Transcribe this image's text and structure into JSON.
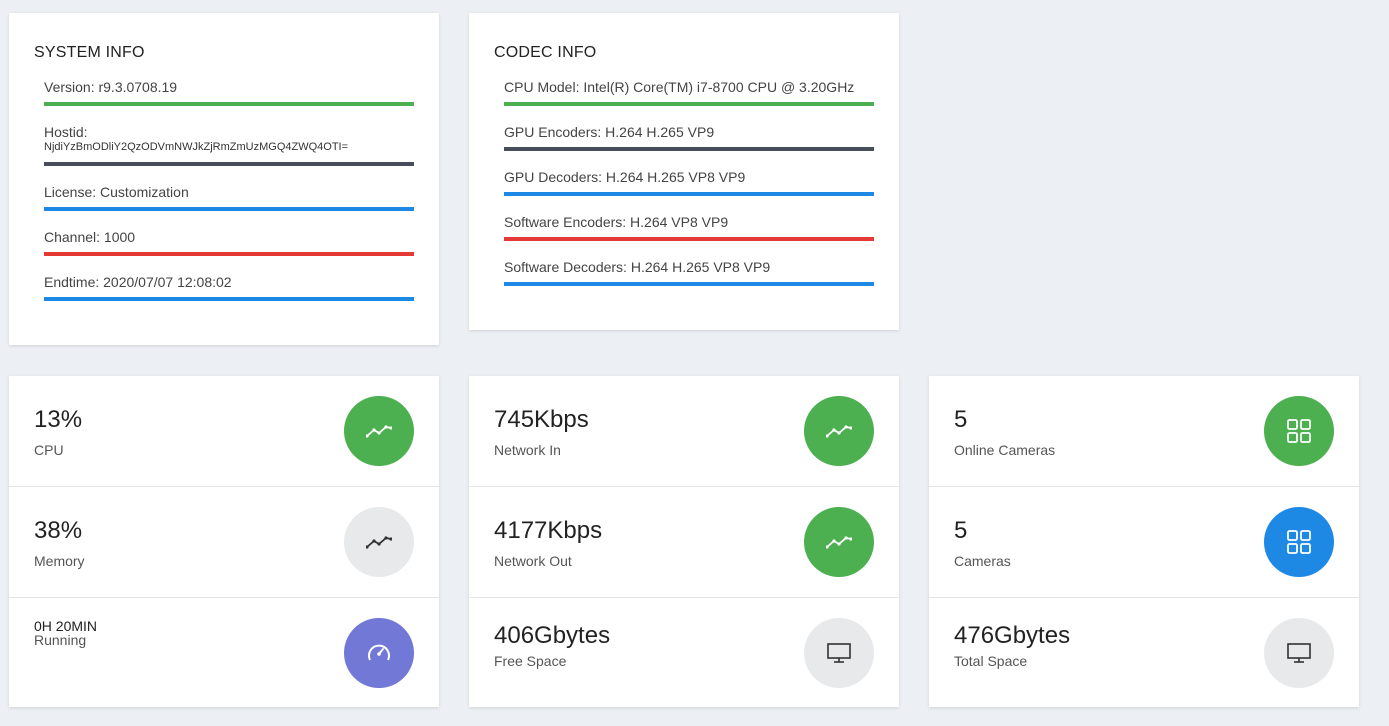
{
  "system_info": {
    "title": "SYSTEM INFO",
    "rows": [
      {
        "text": "Version: r9.3.0708.19",
        "color": "#4caf50"
      },
      {
        "text": "Hostid:",
        "sub": "NjdiYzBmODliY2QzODVmNWJkZjRmZmUzMGQ4ZWQ4OTI=",
        "color": "#474d5a"
      },
      {
        "text": "License: Customization",
        "color": "#1e88e5"
      },
      {
        "text": "Channel: 1000",
        "color": "#e53935"
      },
      {
        "text": "Endtime: 2020/07/07 12:08:02",
        "color": "#1e88e5"
      }
    ]
  },
  "codec_info": {
    "title": "CODEC INFO",
    "rows": [
      {
        "text": "CPU Model: Intel(R) Core(TM) i7-8700 CPU @ 3.20GHz",
        "color": "#4caf50"
      },
      {
        "text": "GPU Encoders: H.264 H.265 VP9",
        "color": "#474d5a"
      },
      {
        "text": "GPU Decoders: H.264 H.265 VP8 VP9",
        "color": "#1e88e5"
      },
      {
        "text": "Software Encoders: H.264 VP8 VP9",
        "color": "#e53935"
      },
      {
        "text": "Software Decoders: H.264 H.265 VP8 VP9",
        "color": "#1e88e5"
      }
    ]
  },
  "stats": {
    "cpu": {
      "value": "13%",
      "label": "CPU",
      "icon": "trend-icon",
      "color": "#4caf50"
    },
    "memory": {
      "value": "38%",
      "label": "Memory",
      "icon": "trend-icon",
      "color": "#e8e9eb"
    },
    "running": {
      "value": "0H 20MIN",
      "label": "Running",
      "icon": "speedometer-icon",
      "color": "#7178d6"
    },
    "network_in": {
      "value": "745Kbps",
      "label": "Network In",
      "icon": "trend-icon",
      "color": "#4caf50"
    },
    "network_out": {
      "value": "4177Kbps",
      "label": "Network Out",
      "icon": "trend-icon",
      "color": "#4caf50"
    },
    "free_space": {
      "value": "406Gbytes",
      "label": "Free Space",
      "icon": "monitor-icon",
      "color": "#e8e9eb"
    },
    "online_cameras": {
      "value": "5",
      "label": "Online Cameras",
      "icon": "grid-icon",
      "color": "#4caf50"
    },
    "cameras": {
      "value": "5",
      "label": "Cameras",
      "icon": "grid-icon",
      "color": "#1e88e5"
    },
    "total_space": {
      "value": "476Gbytes",
      "label": "Total Space",
      "icon": "monitor-icon",
      "color": "#e8e9eb"
    }
  }
}
